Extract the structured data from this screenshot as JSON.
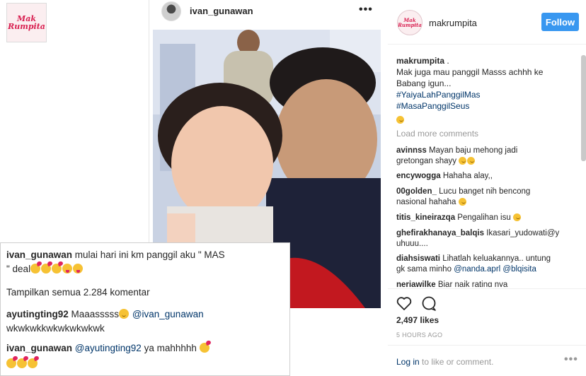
{
  "logo": {
    "line1": "Mak",
    "line2": "Rumpita"
  },
  "post_header": {
    "username": "ivan_gunawan",
    "more_label": "•••"
  },
  "right_panel": {
    "username": "makrumpita",
    "follow_label": "Follow",
    "caption": {
      "user": "makrumpita",
      "suffix": " .",
      "line1": "Mak juga mau panggil Masss achhh ke",
      "line2": "Babang igun...",
      "tag1": "#YaiyaLahPanggilMas",
      "tag2": "#MasaPanggilSeus"
    },
    "load_more": "Load more comments",
    "comments": [
      {
        "user": "avinnss",
        "text": " Mayan baju mehong jadi",
        "text2": "gretongan shayy"
      },
      {
        "user": "encywogga",
        "text": " Hahaha alay,,"
      },
      {
        "user": "00golden_",
        "text": " Lucu banget nih bencong",
        "text2": "nasional hahaha"
      },
      {
        "user": "titis_kineirazqa",
        "text": " Pengalihan isu"
      },
      {
        "user": "ghefirakhanaya_balqis",
        "text": " Ikasari_yudowati@y",
        "text2": "uhuuu...."
      },
      {
        "user": "diahsiswati",
        "text": " Lihatlah keluakannya.. untung",
        "text2_pre": "gk sama minho ",
        "text2_m1": "@nanda.aprl",
        "text2_m2": "@blqisita"
      },
      {
        "user": "neriawilke",
        "text": " Biar naik rating nya"
      }
    ],
    "likes": "2,497 likes",
    "time": "5 HOURS AGO",
    "login_link": "Log in",
    "login_rest": " to like or comment.",
    "more_label": "•••"
  },
  "overlay": {
    "c1_user": "ivan_gunawan",
    "c1_text": " mulai hari ini km panggil aku \" MAS",
    "c1_text2": "\"  deal",
    "show_all": "Tampilkan semua 2.284 komentar",
    "c2_user": "ayutingting92",
    "c2_text": " Maaasssss",
    "c2_mention": "@ivan_gunawan",
    "c2_text2": "wkwkwkkwkwkwkwkwk",
    "c3_user": "ivan_gunawan",
    "c3_mention": "@ayutingting92",
    "c3_text": "  ya mahhhhh"
  },
  "icons": [
    "heart-icon",
    "comment-icon",
    "more-icon",
    "kiss-emoji",
    "tongue-emoji",
    "smile-emoji"
  ],
  "colors": {
    "link": "#003569",
    "follow_button": "#3897f0",
    "muted": "#999999",
    "logo": "#d81e4f"
  }
}
